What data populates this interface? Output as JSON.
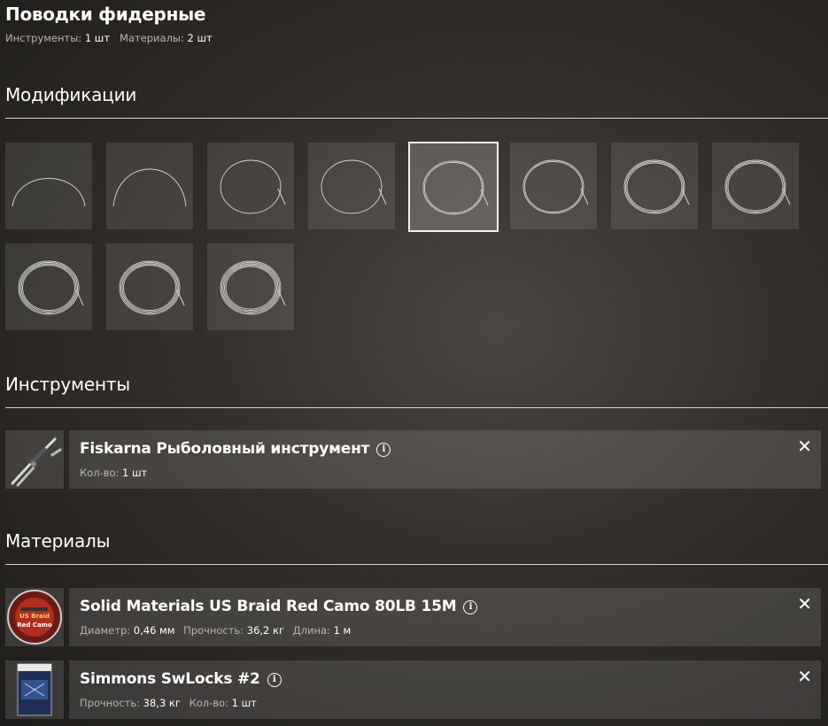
{
  "header": {
    "title": "Поводки фидерные",
    "tools_label": "Инструменты:",
    "tools_value": "1 шт",
    "materials_label": "Материалы:",
    "materials_value": "2 шт"
  },
  "sections": {
    "modifications": "Модификации",
    "tools": "Инструменты",
    "materials": "Материалы"
  },
  "modifications": {
    "selected_index": 4,
    "count": 11
  },
  "tool": {
    "name": "Fiskarna Рыболовный инструмент",
    "info": "i",
    "qty_label": "Кол-во:",
    "qty_value": "1 шт",
    "close": "✕"
  },
  "materials": [
    {
      "name": "Solid Materials US Braid Red Camo 80LB 15M",
      "info": "i",
      "m1_label": "Диаметр:",
      "m1_value": "0,46 мм",
      "m2_label": "Прочность:",
      "m2_value": "36,2 кг",
      "m3_label": "Длина:",
      "m3_value": "1 м",
      "close": "✕",
      "spool_text_1": "US Braid",
      "spool_text_2": "Red Camo"
    },
    {
      "name": "Simmons SwLocks #2",
      "info": "i",
      "m1_label": "Прочность:",
      "m1_value": "38,3 кг",
      "m2_label": "Кол-во:",
      "m2_value": "1 шт",
      "close": "✕"
    }
  ]
}
